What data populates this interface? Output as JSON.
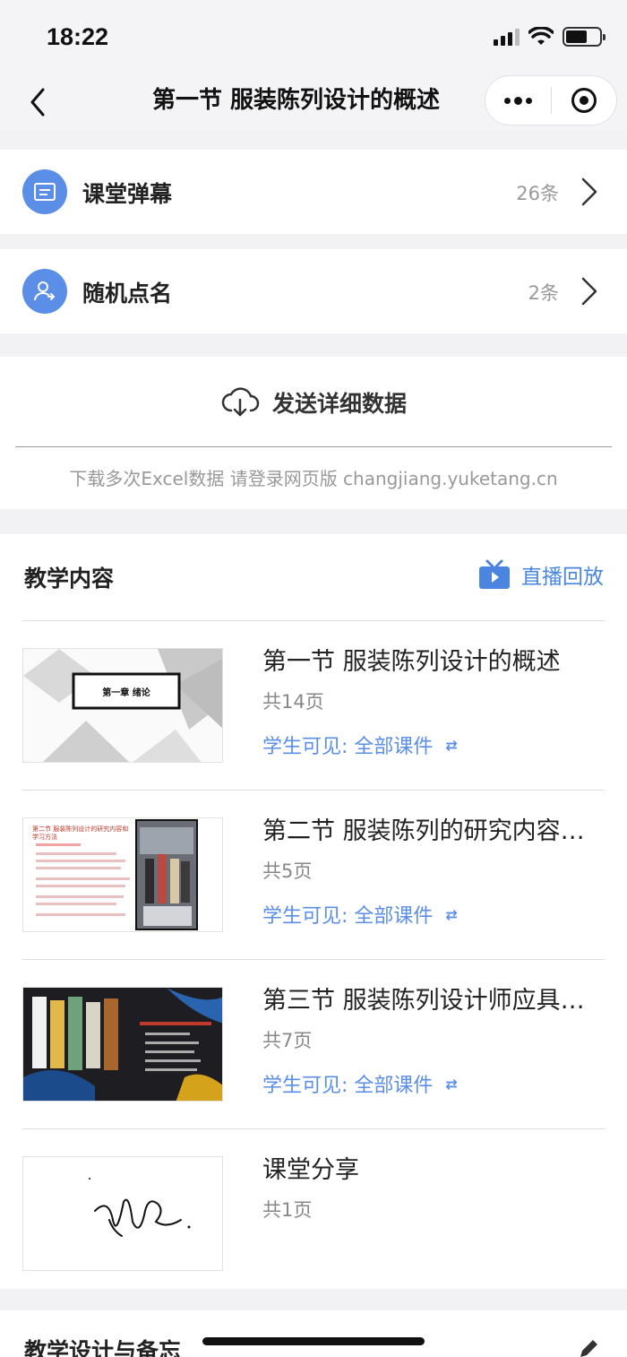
{
  "status_bar": {
    "time": "18:22"
  },
  "nav": {
    "title": "第一节 服装陈列设计的概述"
  },
  "rows": [
    {
      "label": "课堂弹幕",
      "count": "26条"
    },
    {
      "label": "随机点名",
      "count": "2条"
    }
  ],
  "send": {
    "label": "发送详细数据",
    "hint": "下载多次Excel数据 请登录网页版 changjiang.yuketang.cn"
  },
  "content": {
    "section_title": "教学内容",
    "replay_label": "直播回放",
    "items": [
      {
        "title": "第一节 服装陈列设计的概述",
        "pages": "共14页",
        "visibility": "学生可见: 全部课件",
        "thumb_text": "第一章 绪论"
      },
      {
        "title": "第二节 服装陈列的研究内容与学习方法",
        "pages": "共5页",
        "visibility": "学生可见: 全部课件",
        "thumb_text": "第二节 服装陈列设计的研究内容和学习方法"
      },
      {
        "title": "第三节 服装陈列设计师应具备的能力",
        "pages": "共7页",
        "visibility": "学生可见: 全部课件"
      },
      {
        "title": "课堂分享",
        "pages": "共1页"
      }
    ]
  },
  "bottom": {
    "title": "教学设计与备忘"
  },
  "colors": {
    "accent": "#5b8ee6",
    "link": "#4a86e0"
  }
}
